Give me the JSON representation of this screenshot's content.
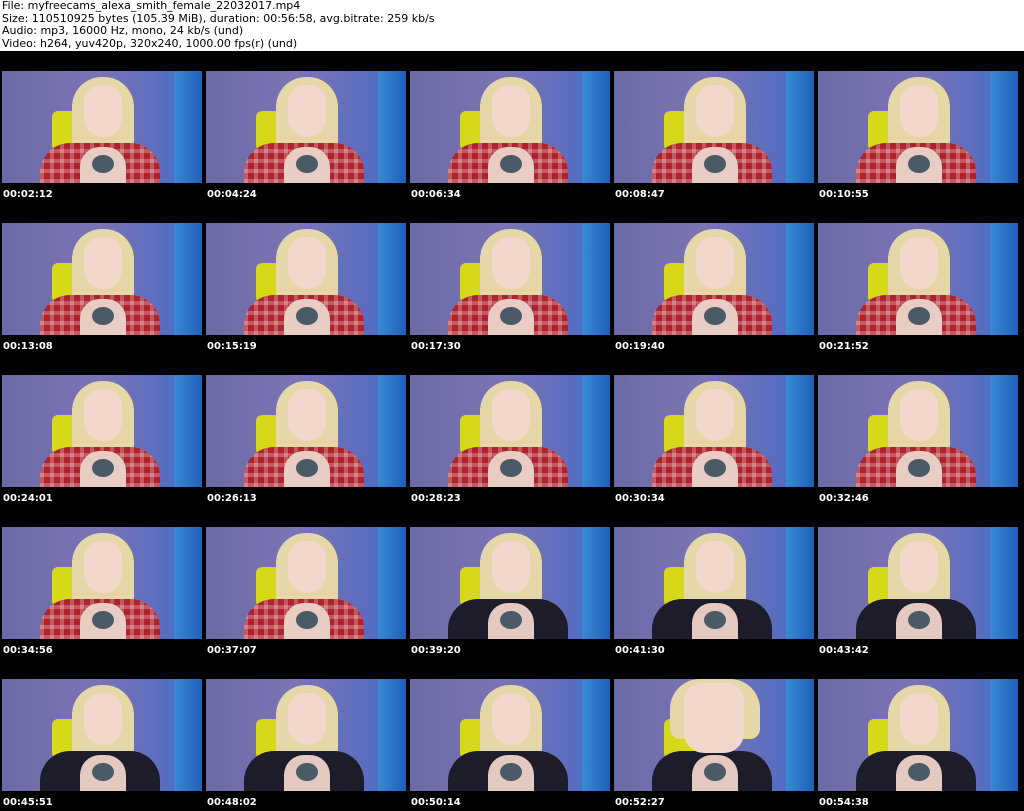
{
  "header": {
    "file_line": "File: myfreecams_alexa_smith_female_22032017.mp4",
    "size_line": "Size: 110510925 bytes (105.39 MiB), duration: 00:56:58, avg.bitrate: 259 kb/s",
    "audio_line": "Audio: mp3, 16000 Hz, mono, 24 kb/s (und)",
    "video_line": "Video: h264, yuv420p, 320x240, 1000.00 fps(r) (und)"
  },
  "thumbnails": [
    {
      "timestamp": "00:02:12"
    },
    {
      "timestamp": "00:04:24"
    },
    {
      "timestamp": "00:06:34"
    },
    {
      "timestamp": "00:08:47"
    },
    {
      "timestamp": "00:10:55"
    },
    {
      "timestamp": "00:13:08"
    },
    {
      "timestamp": "00:15:19"
    },
    {
      "timestamp": "00:17:30"
    },
    {
      "timestamp": "00:19:40"
    },
    {
      "timestamp": "00:21:52"
    },
    {
      "timestamp": "00:24:01"
    },
    {
      "timestamp": "00:26:13"
    },
    {
      "timestamp": "00:28:23"
    },
    {
      "timestamp": "00:30:34"
    },
    {
      "timestamp": "00:32:46"
    },
    {
      "timestamp": "00:34:56"
    },
    {
      "timestamp": "00:37:07"
    },
    {
      "timestamp": "00:39:20"
    },
    {
      "timestamp": "00:41:30"
    },
    {
      "timestamp": "00:43:42"
    },
    {
      "timestamp": "00:45:51"
    },
    {
      "timestamp": "00:48:02"
    },
    {
      "timestamp": "00:50:14"
    },
    {
      "timestamp": "00:52:27"
    },
    {
      "timestamp": "00:54:38"
    }
  ]
}
